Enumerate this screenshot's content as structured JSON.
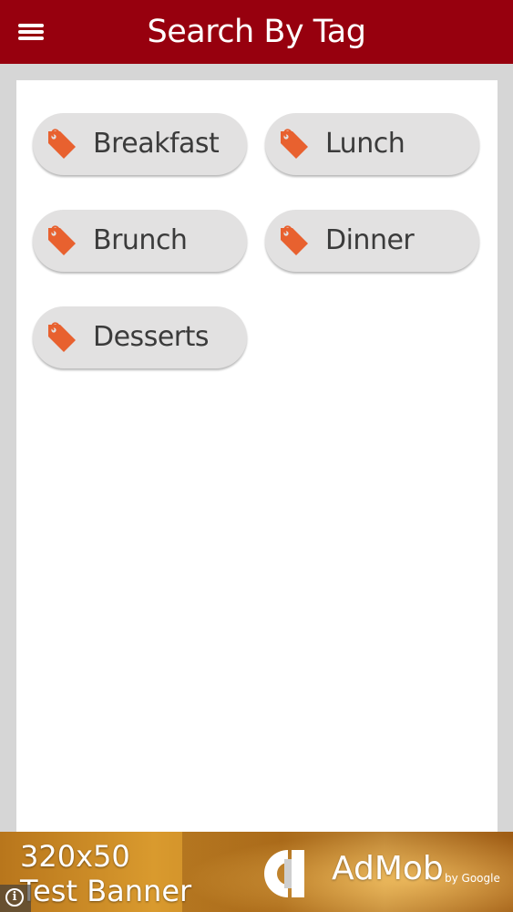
{
  "header": {
    "title": "Search By Tag",
    "menu_icon": "hamburger-menu-icon",
    "background_color": "#97000e"
  },
  "tags": [
    {
      "label": "Breakfast",
      "icon": "tag-icon"
    },
    {
      "label": "Lunch",
      "icon": "tag-icon"
    },
    {
      "label": "Brunch",
      "icon": "tag-icon"
    },
    {
      "label": "Dinner",
      "icon": "tag-icon"
    },
    {
      "label": "Desserts",
      "icon": "tag-icon"
    }
  ],
  "tag_icon_color": "#e8612f",
  "ad_banner": {
    "size_label": "320x50",
    "text": "Test Banner",
    "brand": "AdMob",
    "brand_suffix": "by Google",
    "info_icon": "info-icon"
  }
}
